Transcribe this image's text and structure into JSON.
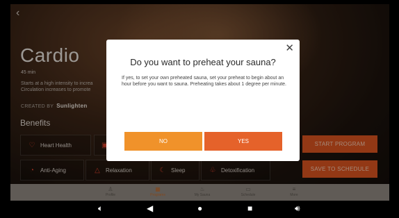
{
  "program": {
    "title": "Cardio",
    "duration": "45 min",
    "description_line1": "Starts at a high intensity to increa",
    "description_line2": "Circulation increases to promote",
    "created_by_label": "CREATED BY",
    "created_by_name": "Sunlighten"
  },
  "benefits": {
    "heading": "Benefits",
    "items": [
      {
        "label": "Heart Health",
        "icon": "heart-icon"
      },
      {
        "label": "",
        "icon": "calendar-icon"
      },
      {
        "label": "Anti-Aging",
        "icon": "clock-icon"
      },
      {
        "label": "Relaxation",
        "icon": "warning-triangle-icon"
      },
      {
        "label": "Sleep",
        "icon": "cloud-moon-icon"
      },
      {
        "label": "Detoxification",
        "icon": "lungs-icon"
      }
    ]
  },
  "actions": {
    "start": "START PROGRAM",
    "save": "SAVE TO SCHEDULE"
  },
  "tabs": [
    {
      "label": "Profile",
      "icon": "profile-icon"
    },
    {
      "label": "Programs",
      "icon": "programs-icon",
      "active": true
    },
    {
      "label": "My Sauna",
      "icon": "sauna-icon"
    },
    {
      "label": "Schedule",
      "icon": "schedule-icon"
    },
    {
      "label": "More",
      "icon": "menu-icon"
    }
  ],
  "modal": {
    "title": "Do you want to preheat your sauna?",
    "body": "If yes, to set your own preheated sauna, set your preheat to begin about an hour before you want to sauna. Preheating takes about 1 degree per minute.",
    "no_label": "NO",
    "yes_label": "YES",
    "close_glyph": "✕"
  },
  "colors": {
    "accent_orange": "#f0922a",
    "accent_deep": "#e5622a",
    "cta": "#d8531f"
  }
}
